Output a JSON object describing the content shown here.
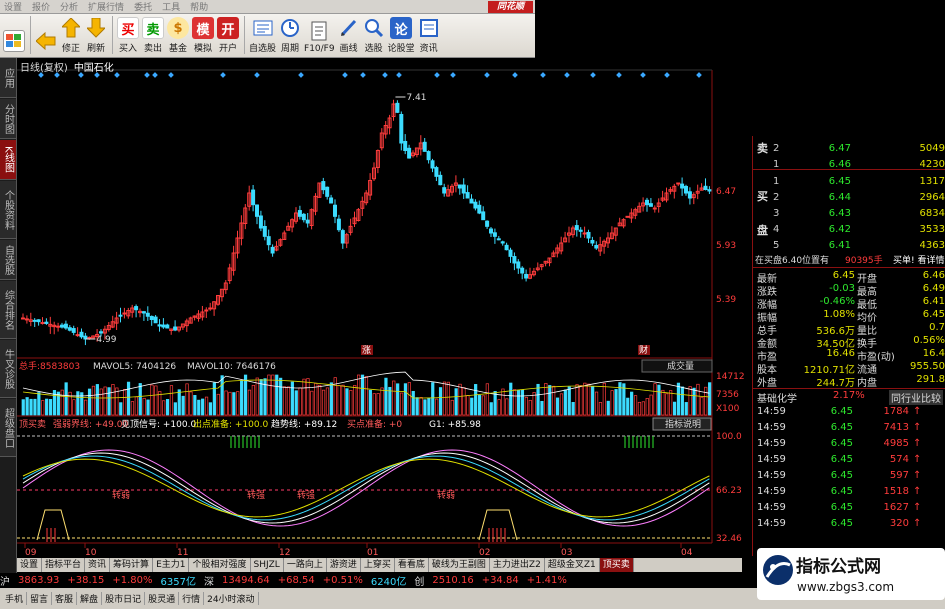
{
  "menu": {
    "items": [
      "设置",
      "报价",
      "分析",
      "扩展行情",
      "委托",
      "工具",
      "帮助"
    ],
    "brand": "同花顺"
  },
  "toolbar": {
    "buttons": [
      {
        "label": "",
        "icon": "layout-icon"
      },
      {
        "label": "",
        "icon": "back-arrow-icon"
      },
      {
        "label": "修正",
        "icon": "up-arrow-icon"
      },
      {
        "label": "刷新",
        "icon": "down-arrow-icon"
      },
      {
        "label": "买入",
        "icon": "buy-icon",
        "glyph": "买"
      },
      {
        "label": "卖出",
        "icon": "sell-icon",
        "glyph": "卖"
      },
      {
        "label": "基金",
        "icon": "fund-icon",
        "glyph": "$"
      },
      {
        "label": "模拟",
        "icon": "simulate-icon",
        "glyph": "模"
      },
      {
        "label": "开户",
        "icon": "open-account-icon",
        "glyph": "开"
      },
      {
        "label": "自选股",
        "icon": "watchlist-icon"
      },
      {
        "label": "周期",
        "icon": "period-icon"
      },
      {
        "label": "F10/F9",
        "icon": "f10-icon"
      },
      {
        "label": "画线",
        "icon": "draw-line-icon"
      },
      {
        "label": "选股",
        "icon": "stock-picker-icon"
      },
      {
        "label": "论股堂",
        "icon": "forum-icon",
        "glyph": "论"
      },
      {
        "label": "资讯",
        "icon": "news-icon"
      }
    ]
  },
  "sidebar": {
    "tabs": [
      "应用",
      "分时图",
      "K线图",
      "个股资料",
      "自选股",
      "综合排名",
      "牛叉诊股",
      "超级盘口"
    ]
  },
  "chart": {
    "period_label": "日线(复权)",
    "stock_name": "中国石化",
    "high_label": "7.41",
    "low_label": "4.99",
    "price_ticks": [
      "6.47",
      "5.93",
      "5.39"
    ],
    "event_markers": [
      "涨",
      "财"
    ],
    "volume_header": {
      "label": "总手:",
      "total": "8583803",
      "mavol5": "MAVOL5: 7404126",
      "mavol10": "MAVOL10: 7646176"
    },
    "volume_dropdown": "成交量",
    "volume_ticks": [
      "14712",
      "7356",
      "X100"
    ],
    "indicator_header": {
      "name": "顶买卖",
      "items": [
        "强弱界线: +49.00",
        "见顶信号: +100.0",
        "出点准备: +100.0",
        "趋势线: +89.12",
        "买点准备: +0",
        "G1: +85.98"
      ]
    },
    "indicator_button": "指标说明",
    "indicator_ticks": [
      "100.0",
      "66.23",
      "32.46"
    ],
    "date_ticks": [
      "09",
      "10",
      "11",
      "12",
      "01",
      "02",
      "03",
      "04"
    ],
    "zone_labels": [
      "转强",
      "转强",
      "转弱",
      "转弱"
    ]
  },
  "orderbook": {
    "sell_label": "卖盘",
    "buy_label": "买盘",
    "asks": [
      {
        "level": "2",
        "price": "6.47",
        "vol": "5049"
      },
      {
        "level": "1",
        "price": "6.46",
        "vol": "4230"
      }
    ],
    "bids": [
      {
        "level": "1",
        "price": "6.45",
        "vol": "1317"
      },
      {
        "level": "2",
        "price": "6.44",
        "vol": "2964"
      },
      {
        "level": "3",
        "price": "6.43",
        "vol": "6834"
      },
      {
        "level": "4",
        "price": "6.42",
        "vol": "3533"
      },
      {
        "level": "5",
        "price": "6.41",
        "vol": "4363"
      }
    ],
    "pending_text": "在买盘6.40位置有",
    "pending_vol": "90395手",
    "pending_link": "买单! 看详情"
  },
  "quote": {
    "rows": [
      {
        "l1": "最新",
        "v1": "6.45",
        "l2": "开盘",
        "v2": "6.46"
      },
      {
        "l1": "涨跌",
        "v1": "-0.03",
        "l2": "最高",
        "v2": "6.49"
      },
      {
        "l1": "涨幅",
        "v1": "-0.46%",
        "l2": "最低",
        "v2": "6.41"
      },
      {
        "l1": "振幅",
        "v1": "1.08%",
        "l2": "均价",
        "v2": "6.45"
      },
      {
        "l1": "总手",
        "v1": "536.6万",
        "l2": "量比",
        "v2": "0.7"
      },
      {
        "l1": "金额",
        "v1": "34.50亿",
        "l2": "换手",
        "v2": "0.56%"
      },
      {
        "l1": "市盈",
        "v1": "16.46",
        "l2": "市盈(动)",
        "v2": "16.4"
      },
      {
        "l1": "股本",
        "v1": "1210.71亿",
        "l2": "流通",
        "v2": "955.50"
      },
      {
        "l1": "外盘",
        "v1": "244.7万",
        "l2": "内盘",
        "v2": "291.8"
      }
    ],
    "sector": "基础化学",
    "sector_change": "2.17%",
    "compare_btn": "同行业比较"
  },
  "ticks": [
    {
      "t": "14:59",
      "p": "6.45",
      "v": "1784"
    },
    {
      "t": "14:59",
      "p": "6.45",
      "v": "7413"
    },
    {
      "t": "14:59",
      "p": "6.45",
      "v": "4985"
    },
    {
      "t": "14:59",
      "p": "6.45",
      "v": "574"
    },
    {
      "t": "14:59",
      "p": "6.45",
      "v": "597"
    },
    {
      "t": "14:59",
      "p": "6.45",
      "v": "1518"
    },
    {
      "t": "14:59",
      "p": "6.45",
      "v": "1627"
    },
    {
      "t": "14:59",
      "p": "6.45",
      "v": "320"
    }
  ],
  "tabs": [
    "设置",
    "指标平台",
    "资讯",
    "筹码计算",
    "E主力1",
    "个股相对强度",
    "SHJZL",
    "一路向上",
    "游资进",
    "上穿买",
    "看看底",
    "破线为王副图",
    "主力进出Z2",
    "超级金叉Z1",
    "顶买卖"
  ],
  "ticker": {
    "sh_label": "沪",
    "sh_index": "3863.93",
    "sh_change": "+38.15",
    "sh_pct": "+1.80%",
    "sh_amount": "6357亿",
    "sz_label": "深",
    "sz_index": "13494.64",
    "sz_change": "+68.54",
    "sz_pct": "+0.51%",
    "sz_amount": "6240亿",
    "cy_label": "创",
    "cy_index": "2510.16",
    "cy_change": "+34.84",
    "cy_pct": "+1.41%"
  },
  "statusbar": {
    "items": [
      "手机",
      "留言",
      "客服",
      "解盘",
      "股市日记",
      "股灵通",
      "行情",
      "24小时滚动"
    ]
  },
  "watermark": {
    "title": "指标公式网",
    "url": "www.zbgs3.com"
  },
  "colors": {
    "up": "#ff3c3c",
    "down": "#3cdcff",
    "green": "#2ee82e",
    "yellow": "#e0e000",
    "grid_red": "#8a1010"
  }
}
